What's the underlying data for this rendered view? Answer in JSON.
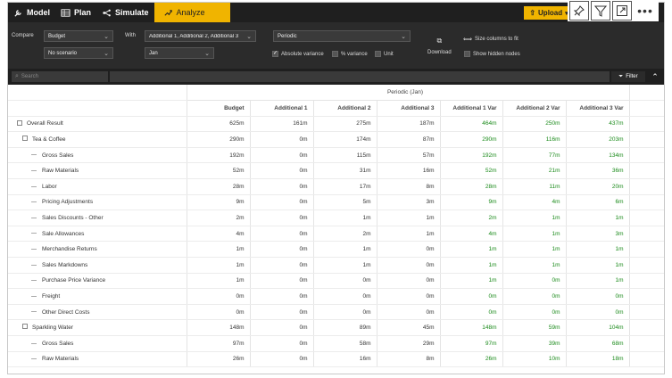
{
  "toolbar": {
    "tabs": [
      {
        "label": "Model",
        "icon": "wrench-icon"
      },
      {
        "label": "Plan",
        "icon": "table-icon"
      },
      {
        "label": "Simulate",
        "icon": "flow-icon"
      },
      {
        "label": "Analyze",
        "icon": "analyze-icon"
      }
    ],
    "upload_label": "Upload",
    "accent": "#f0b400"
  },
  "controls": {
    "compare_label": "Compare",
    "compare_value": "Budget",
    "scenario_value": "No scenario",
    "with_label": "With",
    "with_value": "Additional 1, Additional 2, Additional 3",
    "with_sub_value": "Jan",
    "period_value": "Periodic",
    "abs_variance_label": "Absolute variance",
    "pct_variance_label": "% variance",
    "unit_label": "Unit",
    "download_label": "Download",
    "size_columns_label": "Size columns to fit",
    "show_hidden_label": "Show hidden nodes"
  },
  "search": {
    "placeholder": "Search",
    "filter_label": "Filter"
  },
  "table": {
    "group_header": "Periodic (Jan)",
    "columns": [
      "Budget",
      "Additional 1",
      "Additional 2",
      "Additional 3",
      "Additional 1 Var",
      "Additional 2 Var",
      "Additional 3 Var"
    ],
    "rows": [
      {
        "name": "Overall Result",
        "level": 0,
        "kind": "group",
        "values": [
          "625m",
          "161m",
          "275m",
          "187m",
          "464m",
          "250m",
          "437m"
        ]
      },
      {
        "name": "Tea & Coffee",
        "level": 1,
        "kind": "group",
        "values": [
          "290m",
          "0m",
          "174m",
          "87m",
          "290m",
          "116m",
          "203m"
        ]
      },
      {
        "name": "Gross Sales",
        "level": 2,
        "kind": "leaf",
        "values": [
          "192m",
          "0m",
          "115m",
          "57m",
          "192m",
          "77m",
          "134m"
        ]
      },
      {
        "name": "Raw Materials",
        "level": 2,
        "kind": "leaf",
        "values": [
          "52m",
          "0m",
          "31m",
          "16m",
          "52m",
          "21m",
          "36m"
        ]
      },
      {
        "name": "Labor",
        "level": 2,
        "kind": "leaf",
        "values": [
          "28m",
          "0m",
          "17m",
          "8m",
          "28m",
          "11m",
          "20m"
        ]
      },
      {
        "name": "Pricing Adjustments",
        "level": 2,
        "kind": "leaf",
        "values": [
          "9m",
          "0m",
          "5m",
          "3m",
          "9m",
          "4m",
          "6m"
        ]
      },
      {
        "name": "Sales Discounts - Other",
        "level": 2,
        "kind": "leaf",
        "values": [
          "2m",
          "0m",
          "1m",
          "1m",
          "2m",
          "1m",
          "1m"
        ]
      },
      {
        "name": "Sale Allowances",
        "level": 2,
        "kind": "leaf",
        "values": [
          "4m",
          "0m",
          "2m",
          "1m",
          "4m",
          "1m",
          "3m"
        ]
      },
      {
        "name": "Merchandise Returns",
        "level": 2,
        "kind": "leaf",
        "values": [
          "1m",
          "0m",
          "1m",
          "0m",
          "1m",
          "1m",
          "1m"
        ]
      },
      {
        "name": "Sales Markdowns",
        "level": 2,
        "kind": "leaf",
        "values": [
          "1m",
          "0m",
          "1m",
          "0m",
          "1m",
          "1m",
          "1m"
        ]
      },
      {
        "name": "Purchase Price Variance",
        "level": 2,
        "kind": "leaf",
        "values": [
          "1m",
          "0m",
          "0m",
          "0m",
          "1m",
          "0m",
          "1m"
        ]
      },
      {
        "name": "Freight",
        "level": 2,
        "kind": "leaf",
        "values": [
          "0m",
          "0m",
          "0m",
          "0m",
          "0m",
          "0m",
          "0m"
        ]
      },
      {
        "name": "Other Direct Costs",
        "level": 2,
        "kind": "leaf",
        "values": [
          "0m",
          "0m",
          "0m",
          "0m",
          "0m",
          "0m",
          "0m"
        ]
      },
      {
        "name": "Sparkling Water",
        "level": 1,
        "kind": "group",
        "values": [
          "148m",
          "0m",
          "89m",
          "45m",
          "148m",
          "59m",
          "104m"
        ]
      },
      {
        "name": "Gross Sales",
        "level": 2,
        "kind": "leaf",
        "values": [
          "97m",
          "0m",
          "58m",
          "29m",
          "97m",
          "39m",
          "68m"
        ]
      },
      {
        "name": "Raw Materials",
        "level": 2,
        "kind": "leaf",
        "values": [
          "26m",
          "0m",
          "16m",
          "8m",
          "26m",
          "10m",
          "18m"
        ]
      }
    ],
    "variance_color": "#1a8a1a"
  }
}
